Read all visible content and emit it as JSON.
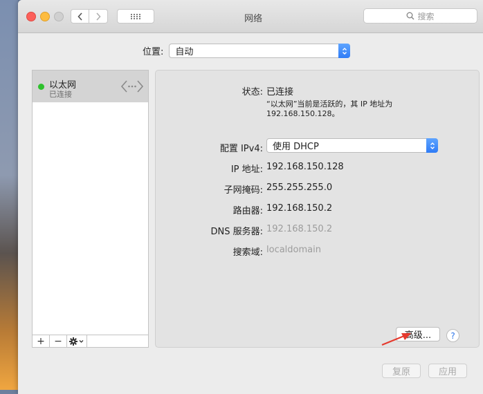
{
  "window": {
    "title": "网络"
  },
  "toolbar": {
    "search_placeholder": "搜索"
  },
  "location": {
    "label": "位置:",
    "value": "自动"
  },
  "sidebar": {
    "items": [
      {
        "name": "以太网",
        "status": "已连接",
        "status_color": "#2ec12d"
      }
    ],
    "tools": {
      "add": "+",
      "remove": "−"
    }
  },
  "detail": {
    "status_label": "状态:",
    "status_value": "已连接",
    "status_desc_line1": "“以太网”当前是活跃的，其 IP 地址为",
    "status_desc_line2": "192.168.150.128。",
    "ipv4_label": "配置 IPv4:",
    "ipv4_value": "使用 DHCP",
    "ip_label": "IP 地址:",
    "ip_value": "192.168.150.128",
    "mask_label": "子网掩码:",
    "mask_value": "255.255.255.0",
    "router_label": "路由器:",
    "router_value": "192.168.150.2",
    "dns_label": "DNS 服务器:",
    "dns_value": "192.168.150.2",
    "search_domain_label": "搜索域:",
    "search_domain_value": "localdomain",
    "advanced_button": "高级...",
    "help_button": "?"
  },
  "footer": {
    "revert_button": "复原",
    "apply_button": "应用"
  },
  "colors": {
    "accent": "#2f7cf6",
    "close": "#fc605b",
    "minimize": "#fdbc40"
  }
}
